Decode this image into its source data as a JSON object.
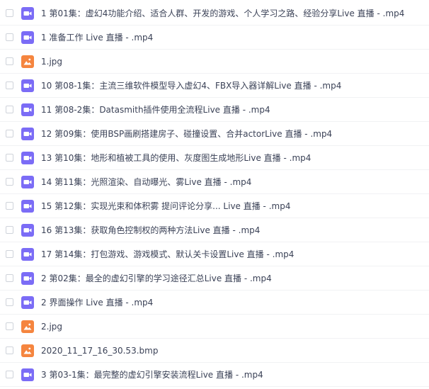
{
  "files": [
    {
      "name": "1 第01集：虚幻4功能介绍、适合人群、开发的游戏、个人学习之路、经验分享Live 直播 - .mp4",
      "type": "video"
    },
    {
      "name": "1 准备工作 Live 直播 - .mp4",
      "type": "video"
    },
    {
      "name": "1.jpg",
      "type": "image"
    },
    {
      "name": "10 第08-1集：主流三维软件模型导入虚幻4、FBX导入器详解Live 直播 - .mp4",
      "type": "video"
    },
    {
      "name": "11 第08-2集：Datasmith插件使用全流程Live 直播 - .mp4",
      "type": "video"
    },
    {
      "name": "12 第09集：使用BSP画刷搭建房子、碰撞设置、合并actorLive 直播 - .mp4",
      "type": "video"
    },
    {
      "name": "13 第10集：地形和植被工具的使用、灰度图生成地形Live 直播 - .mp4",
      "type": "video"
    },
    {
      "name": "14 第11集：光照渲染、自动曝光、雾Live 直播 - .mp4",
      "type": "video"
    },
    {
      "name": "15 第12集：实现光束和体积雾 提问评论分享... Live 直播 - .mp4",
      "type": "video"
    },
    {
      "name": "16 第13集：获取角色控制权的两种方法Live 直播 - .mp4",
      "type": "video"
    },
    {
      "name": "17 第14集：打包游戏、游戏模式、默认关卡设置Live 直播 - .mp4",
      "type": "video"
    },
    {
      "name": "2 第02集：最全的虚幻引擎的学习途径汇总Live 直播 - .mp4",
      "type": "video"
    },
    {
      "name": "2 界面操作 Live 直播 - .mp4",
      "type": "video"
    },
    {
      "name": "2.jpg",
      "type": "image"
    },
    {
      "name": "2020_11_17_16_30.53.bmp",
      "type": "image"
    },
    {
      "name": "3 第03-1集：最完整的虚幻引擎安装流程Live 直播 - .mp4",
      "type": "video"
    }
  ],
  "colors": {
    "video_icon": "#7b6cf6",
    "image_icon": "#f5853f",
    "text": "#3b4257",
    "divider": "#f1f2f4",
    "checkbox_border": "#cfd3da"
  }
}
